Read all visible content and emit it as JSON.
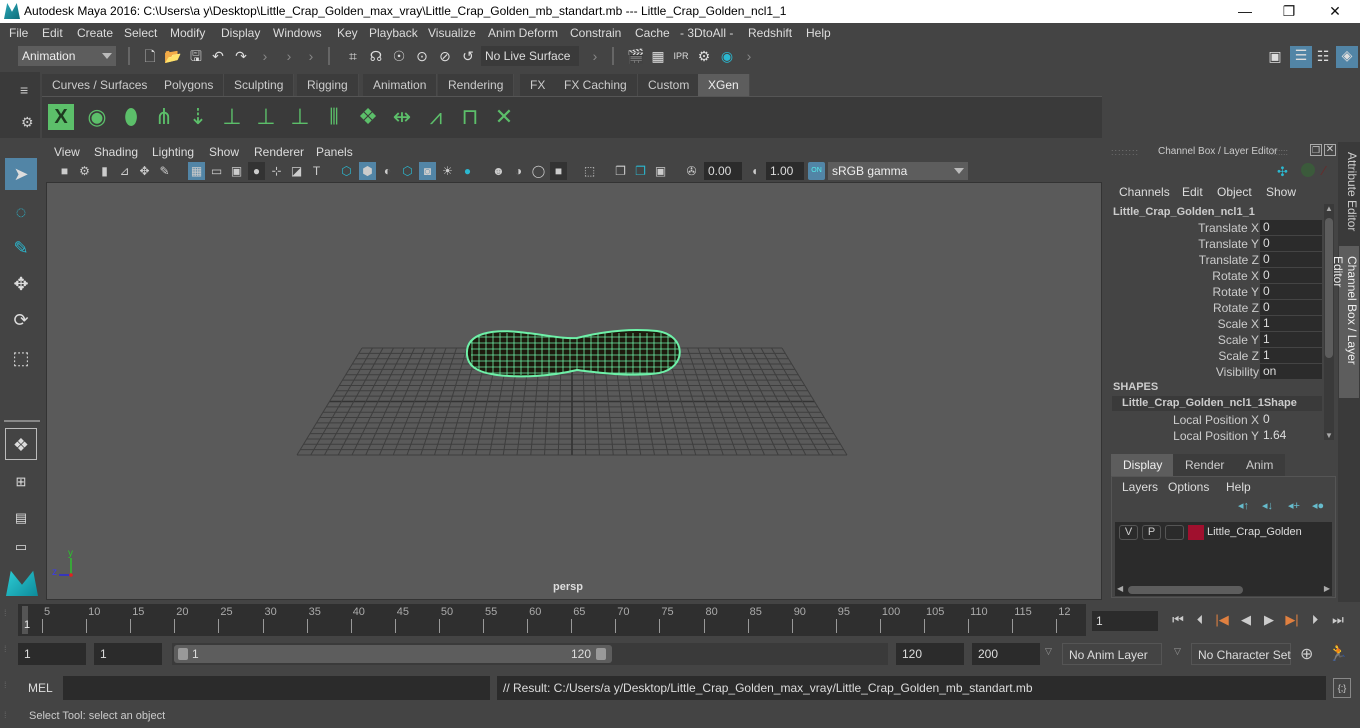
{
  "window": {
    "title": "Autodesk Maya 2016: C:\\Users\\a y\\Desktop\\Little_Crap_Golden_max_vray\\Little_Crap_Golden_mb_standart.mb   ---   Little_Crap_Golden_ncl1_1",
    "minimize": "—",
    "maximize": "❐",
    "close": "✕"
  },
  "menubar": [
    "File",
    "Edit",
    "Create",
    "Select",
    "Modify",
    "Display",
    "Windows",
    "Key",
    "Playback",
    "Visualize",
    "Anim Deform",
    "Constrain",
    "Cache",
    "- 3DtoAll -",
    "Redshift",
    "Help"
  ],
  "statusline": {
    "menuset": "Animation",
    "live_surface": "No Live Surface"
  },
  "shelf": {
    "tabs": [
      "Curves / Surfaces",
      "Polygons",
      "Sculpting",
      "Rigging",
      "Animation",
      "Rendering",
      "FX",
      "FX Caching",
      "Custom",
      "XGen"
    ],
    "active_tab": "XGen",
    "icons": [
      "xgen-window-icon",
      "xgen-preview-icon",
      "xgen-clear-preview-icon",
      "add-description-icon",
      "import-icon",
      "add-guide-icon",
      "show-guide-icon",
      "lock-guide-icon",
      "guide-split-icon",
      "groom-grid-icon",
      "flip-guides-icon",
      "select-guides-icon",
      "guide-box-icon",
      "delete-guide-icon"
    ]
  },
  "viewport": {
    "menus": [
      "View",
      "Shading",
      "Lighting",
      "Show",
      "Renderer",
      "Panels"
    ],
    "exposure": "0.00",
    "gamma": "1.00",
    "color_space": "sRGB gamma",
    "color_mgmt_badge": "ON",
    "camera_label": "persp",
    "axis": {
      "y": "y",
      "z": "z"
    },
    "wire_color": "#6ef0a8"
  },
  "channel_box": {
    "title": "Channel Box / Layer Editor",
    "menus": [
      "Channels",
      "Edit",
      "Object",
      "Show"
    ],
    "object_name": "Little_Crap_Golden_ncl1_1",
    "attributes": [
      {
        "label": "Translate X",
        "value": "0"
      },
      {
        "label": "Translate Y",
        "value": "0"
      },
      {
        "label": "Translate Z",
        "value": "0"
      },
      {
        "label": "Rotate X",
        "value": "0"
      },
      {
        "label": "Rotate Y",
        "value": "0"
      },
      {
        "label": "Rotate Z",
        "value": "0"
      },
      {
        "label": "Scale X",
        "value": "1"
      },
      {
        "label": "Scale Y",
        "value": "1"
      },
      {
        "label": "Scale Z",
        "value": "1"
      },
      {
        "label": "Visibility",
        "value": "on"
      }
    ],
    "shapes_header": "SHAPES",
    "shape_name": "Little_Crap_Golden_ncl1_1Shape",
    "shape_attributes": [
      {
        "label": "Local Position X",
        "value": "0"
      },
      {
        "label": "Local Position Y",
        "value": "1.64"
      }
    ]
  },
  "side_tabs": [
    "Attribute Editor",
    "Channel Box / Layer Editor"
  ],
  "layer_editor": {
    "tabs": [
      "Display",
      "Render",
      "Anim"
    ],
    "active_tab": "Display",
    "menus": [
      "Layers",
      "Options",
      "Help"
    ],
    "layers": [
      {
        "v": "V",
        "p": "P",
        "name": "Little_Crap_Golden",
        "color": "#a0102e"
      }
    ]
  },
  "timeline": {
    "ticks": [
      "5",
      "10",
      "15",
      "20",
      "25",
      "30",
      "35",
      "40",
      "45",
      "50",
      "55",
      "60",
      "65",
      "70",
      "75",
      "80",
      "85",
      "90",
      "95",
      "100",
      "105",
      "110",
      "115",
      "12"
    ],
    "current_frame_marker": "1",
    "current_frame": "1"
  },
  "range": {
    "start": "1",
    "playback_start": "1",
    "slider_start": "1",
    "slider_end": "120",
    "playback_end": "120",
    "end": "200",
    "anim_layer": "No Anim Layer",
    "character_set": "No Character Set"
  },
  "command_line": {
    "label": "MEL",
    "input": "",
    "result": "// Result: C:/Users/a y/Desktop/Little_Crap_Golden_max_vray/Little_Crap_Golden_mb_standart.mb"
  },
  "help_line": "Select Tool: select an object"
}
